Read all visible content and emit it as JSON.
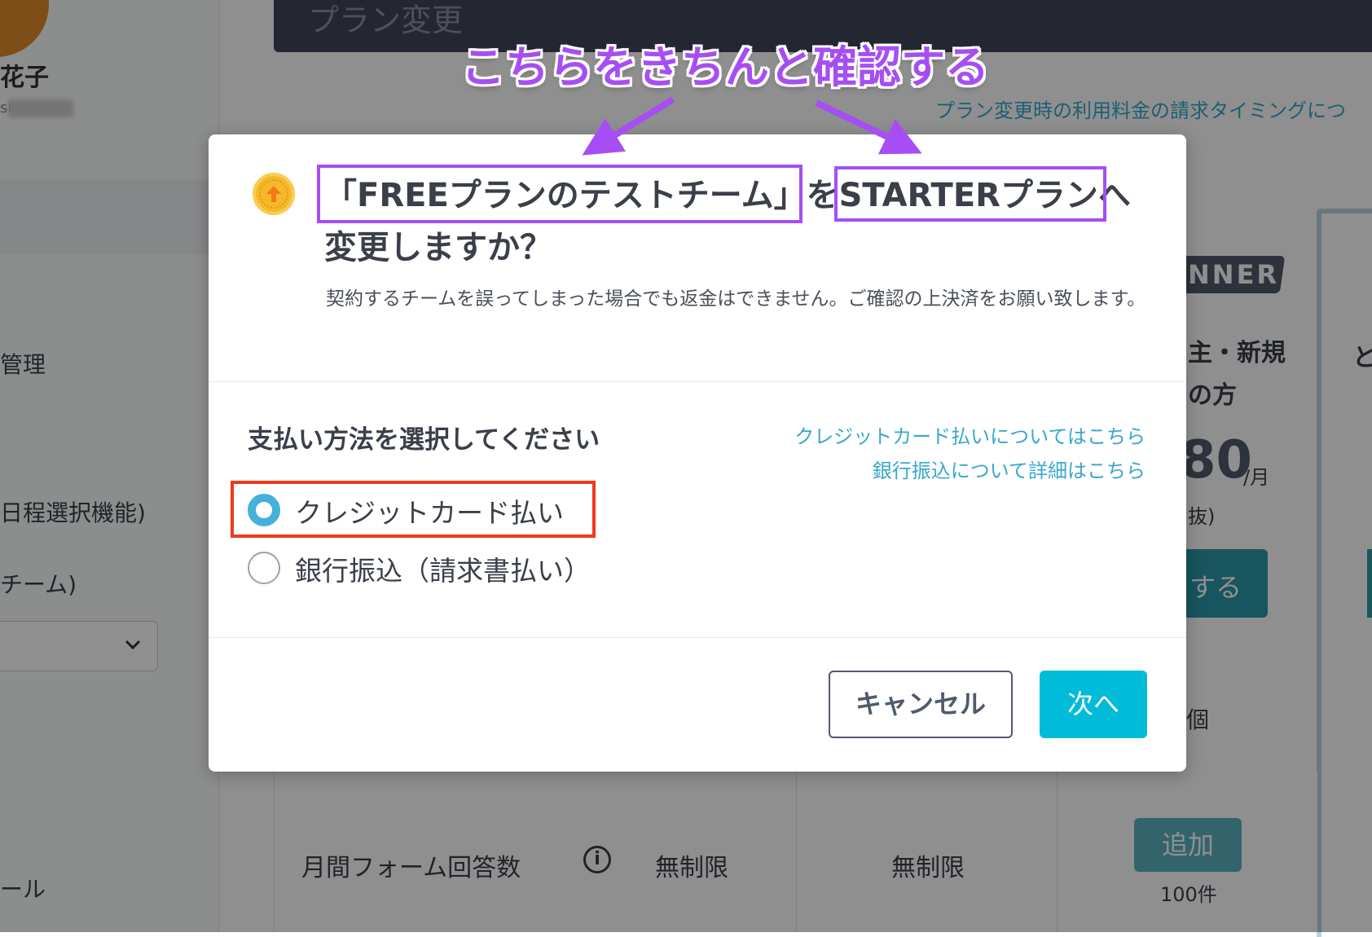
{
  "sidebar": {
    "user_name": "花子",
    "user_id": "si",
    "items": [
      {
        "label": "管理"
      },
      {
        "label": "日程選択機能)"
      },
      {
        "label": "チーム)"
      },
      {
        "label": "ール"
      }
    ]
  },
  "header": {
    "title": "プラン変更",
    "info_link": "プラン変更時の利用料金の請求タイミングにつ"
  },
  "plan_card": {
    "banner": "NNER",
    "line1": "主・新規",
    "line2": "の方",
    "price": "80",
    "per": "/月",
    "tax": "抜)",
    "cta": "する",
    "count": "個",
    "partial_char": "と"
  },
  "table": {
    "row_label": "月間フォーム回答数",
    "info_icon_glyph": "i",
    "cells": [
      "無制限",
      "無制限"
    ],
    "add_button": "追加",
    "add_sub": "100件"
  },
  "annotation": {
    "title": "こちらをきちんと確認する",
    "accent_color": "#a64ef4",
    "highlight_color": "#f0391a"
  },
  "modal": {
    "icon": "upgrade-coin-icon",
    "title_team": "「FREEプランのテストチーム」",
    "title_wo": "を",
    "title_plan": "STARTERプラン",
    "title_he": "へ",
    "title_line2": "変更しますか？",
    "description": "契約するチームを誤ってしまった場合でも返金はできません。ご確認の上決済をお願い致します。",
    "payment_heading": "支払い方法を選択してください",
    "links": {
      "credit": "クレジットカード払いについてはこちら",
      "bank": "銀行振込について詳細はこちら"
    },
    "options": [
      {
        "label": "クレジットカード払い",
        "checked": true
      },
      {
        "label": "銀行振込（請求書払い）",
        "checked": false
      }
    ],
    "cancel_label": "キャンセル",
    "next_label": "次へ"
  }
}
